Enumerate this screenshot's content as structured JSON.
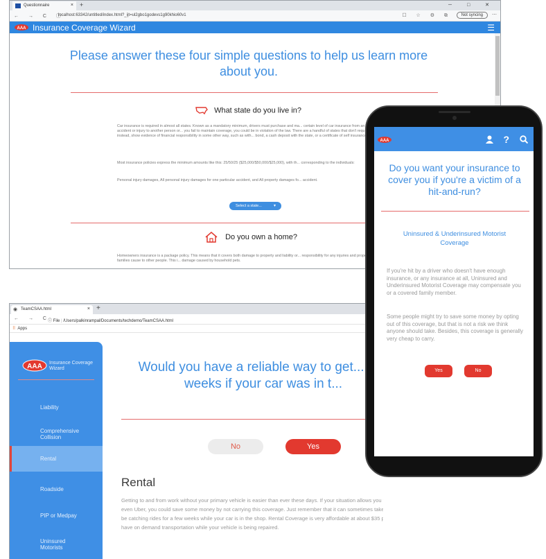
{
  "window1": {
    "tab_title": "Questionnaire",
    "tab_close": "×",
    "new_tab": "+",
    "window_controls": "─ □ ✕",
    "nav_icons": "← → C ⓘ",
    "url": "localhost:63342/untitled/index.html?_ijt=ul2gbo1godevs1g90khio60v1",
    "sync_label": "Not syncing",
    "app_title": "Insurance Coverage Wizard",
    "intro": "Please answer these four simple questions to help us learn more about you.",
    "q_state": "What state do you live in?",
    "state_para1": "Car insurance is required in almost all states. Known as a mandatory minimum, drivers must purchase and ma... certain level of car insurance from an insurance company in case of an accident or injury to another person or... you fail to maintain coverage, you could be in violation of the law. There are a handful of states that don't requ... purchase car insurance, but instead, show evidence of financial responsibility in some other way, such as with... bond, a cash deposit with the state, or a certificate of self insurance.",
    "state_para2": "Most insurance policies express the minimum amounts like this: 25/50/25 ($25,000/$50,000/$25,000), with th... corresponding to the individuals:",
    "state_para3": "Personal injury damages, All personal injury damages for one particular accident, and All property damages fo... accident.",
    "select_label": "Select a state...",
    "q_home": "Do you own a home?",
    "home_para": "Homeowners insurance is a package policy. This means that it covers both damage to property and liability or... responsibility for any injuries and property damage policyholders or their families cause to other people. This i... damage caused by household pets."
  },
  "window2": {
    "tab_title": "TeamCSAA.html",
    "tab_close": "×",
    "new_tab": "+",
    "nav_icons": "← → C",
    "url_prefix": "ⓘ File",
    "url": "/Users/palkinrampal/Documents/techdemo/TeamCSAA.html",
    "apps_label": "Apps",
    "brand_text": "Insurance Coverage Wizard",
    "nav": [
      "Liability",
      "Comprehensive Collision",
      "Rental",
      "Roadside",
      "PIP or Medpay",
      "Uninsured Motorists"
    ],
    "active_nav": "Rental",
    "question": "Would you have a reliable way to get... two weeks if your car was in t...",
    "no_label": "No",
    "yes_label": "Yes",
    "section_title": "Rental",
    "section_text": "Getting to and from work without your primary vehicle is easier than ever these days. If your situation allows you to get around via a friend, family member, or even Uber, you could save some money by not carrying this coverage. Just remember that it can sometimes take a while to get your car repaired, and you may be catching rides for a few weeks while your car is in the shop. Rental Coverage is very affordable at about $35 per year and can give you the peace of mind to have on demand transportation while your vehicle is being repaired."
  },
  "phone": {
    "question": "Do you want your insurance to cover you if you're a victim of a hit-and-run?",
    "coverage_title": "Uninsured & Underinsured Motorist Coverage",
    "para1": "If you're hit by a driver who doesn't have enough insurance, or any insurance at all, Uninsured and Underinsured Motorist Coverage may compensate you or a covered family member.",
    "para2": "Some people might try to save some money by opting out of this coverage, but that is not a risk we think anyone should take. Besides, this coverage is generally very cheap to carry.",
    "yes_label": "Yes",
    "no_label": "No"
  },
  "colors": {
    "brand_blue": "#3f8fe5",
    "accent_red": "#e2392f",
    "divider_red": "#e56a6a"
  }
}
